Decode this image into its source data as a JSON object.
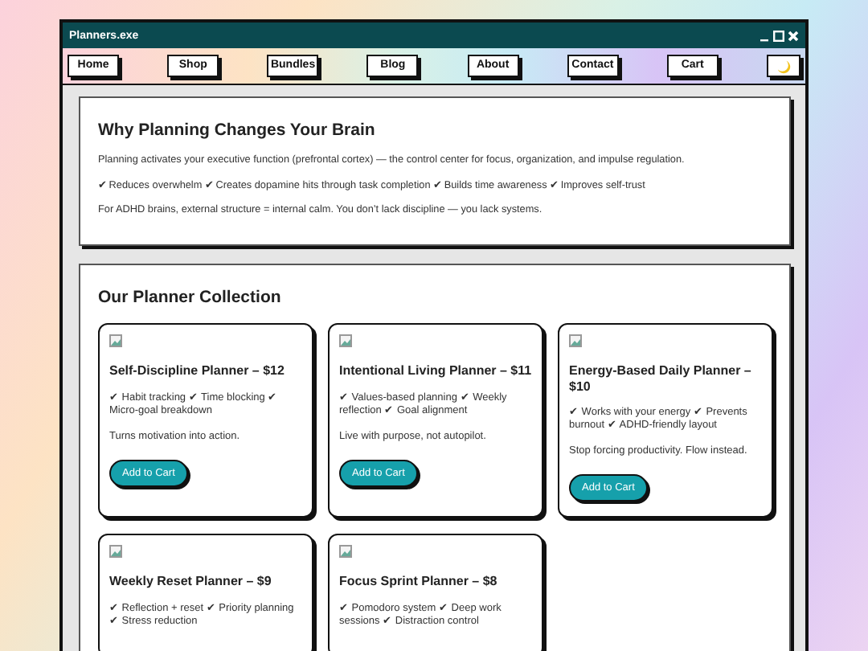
{
  "window": {
    "title": "Planners.exe"
  },
  "nav": [
    {
      "label": "Home"
    },
    {
      "label": "Shop"
    },
    {
      "label": "Bundles"
    },
    {
      "label": "Blog"
    },
    {
      "label": "About"
    },
    {
      "label": "Contact"
    },
    {
      "label": "Cart"
    }
  ],
  "intro": {
    "heading": "Why Planning Changes Your Brain",
    "paragraphs": [
      "Planning activates your executive function (prefrontal cortex) — the control center for focus, organization, and impulse regulation.",
      "✔ Reduces overwhelm ✔ Creates dopamine hits through task completion ✔ Builds time awareness ✔ Improves self-trust",
      "For ADHD brains, external structure = internal calm. You don’t lack discipline — you lack systems."
    ]
  },
  "collection": {
    "heading": "Our Planner Collection",
    "cards": [
      {
        "title": "Self-Discipline Planner – $12",
        "features": "✔ Habit tracking ✔ Time blocking ✔ Micro-goal breakdown",
        "tagline": "Turns motivation into action.",
        "button": "Add to Cart"
      },
      {
        "title": "Intentional Living Planner – $11",
        "features": "✔ Values-based planning ✔ Weekly reflection ✔ Goal alignment",
        "tagline": "Live with purpose, not autopilot.",
        "button": "Add to Cart"
      },
      {
        "title": "Energy-Based Daily Planner – $10",
        "features": "✔ Works with your energy ✔ Prevents burnout ✔ ADHD-friendly layout",
        "tagline": "Stop forcing productivity. Flow instead.",
        "button": "Add to Cart"
      },
      {
        "title": "Weekly Reset Planner – $9",
        "features": "✔ Reflection + reset ✔ Priority planning ✔ Stress reduction"
      },
      {
        "title": "Focus Sprint Planner – $8",
        "features": "✔ Pomodoro system ✔ Deep work sessions ✔ Distraction control"
      }
    ]
  }
}
